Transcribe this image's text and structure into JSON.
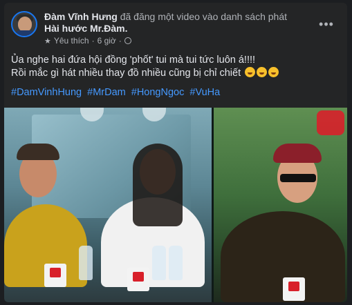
{
  "post": {
    "author": "Đàm Vĩnh Hưng",
    "action": "đã đăng một video vào danh sách phát",
    "playlist": "Hài hước Mr.Đàm",
    "meta_label": "Yêu thích",
    "meta_sep": "·",
    "meta_time": "6 giờ",
    "meta_sep2": "·",
    "more_label": "•••",
    "text_line1": "Ủa nghe hai đứa hội đồng 'phốt' tui mà tui tức luôn á!!!!",
    "text_line2": "Rồi mắc gì hát nhiều thay đồ nhiều cũng bị chỉ chiết",
    "hashtags": [
      "#DamVinhHung",
      "#MrDam",
      "#HongNgoc",
      "#VuHa"
    ]
  },
  "icons": {
    "star": "star-icon",
    "globe": "globe-icon",
    "emoji": "laughing-emoji-icon"
  },
  "colors": {
    "card_bg": "#242526",
    "hashtag": "#4599ff",
    "muted": "#b0b3b8"
  }
}
